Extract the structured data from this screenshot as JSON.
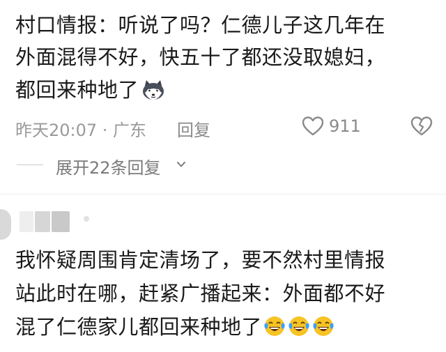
{
  "comments": [
    {
      "lines": [
        "村口情报：听说了吗？仁德儿子这几年在",
        "外面混得不好，快五十了都还没取媳妇，",
        "都回来种地了"
      ],
      "emoji": "husky-emoji",
      "meta": {
        "time_location": "昨天20:07 · 广东",
        "reply_label": "回复",
        "like_count": "911"
      },
      "expand_label": "展开22条回复"
    },
    {
      "lines": [
        "我怀疑周围肯定清场了，要不然村里情报",
        "站此时在哪，赶紧广播起来：外面都不好",
        "混了仁德家儿都回来种地了"
      ],
      "emoji": "laugh-cry-emoji"
    }
  ],
  "icons": {
    "like": "heart-outline-icon",
    "dislike": "broken-heart-icon",
    "expand": "chevron-down-icon"
  },
  "colors": {
    "text": "#1a1a1a",
    "meta": "#9a9a9a",
    "divider": "#eeeeee"
  }
}
